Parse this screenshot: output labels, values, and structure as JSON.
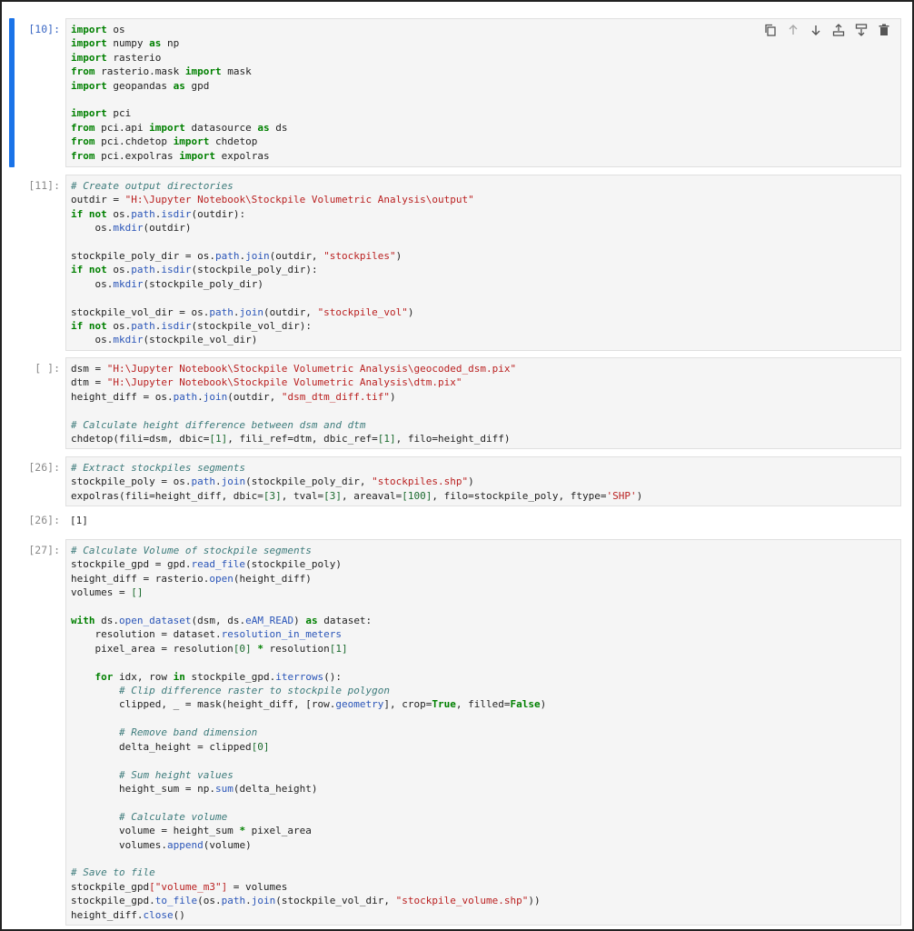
{
  "cells": [
    {
      "prompt": "[10]:",
      "active": true,
      "lines": [
        [
          [
            "k",
            "import"
          ],
          [
            "t",
            " os"
          ]
        ],
        [
          [
            "k",
            "import"
          ],
          [
            "t",
            " numpy "
          ],
          [
            "k",
            "as"
          ],
          [
            "t",
            " np"
          ]
        ],
        [
          [
            "k",
            "import"
          ],
          [
            "t",
            " rasterio"
          ]
        ],
        [
          [
            "k",
            "from"
          ],
          [
            "t",
            " rasterio.mask "
          ],
          [
            "k",
            "import"
          ],
          [
            "t",
            " mask"
          ]
        ],
        [
          [
            "k",
            "import"
          ],
          [
            "t",
            " geopandas "
          ],
          [
            "k",
            "as"
          ],
          [
            "t",
            " gpd"
          ]
        ],
        [],
        [
          [
            "k",
            "import"
          ],
          [
            "t",
            " pci"
          ]
        ],
        [
          [
            "k",
            "from"
          ],
          [
            "t",
            " pci.api "
          ],
          [
            "k",
            "import"
          ],
          [
            "t",
            " datasource "
          ],
          [
            "k",
            "as"
          ],
          [
            "t",
            " ds"
          ]
        ],
        [
          [
            "k",
            "from"
          ],
          [
            "t",
            " pci.chdetop "
          ],
          [
            "k",
            "import"
          ],
          [
            "t",
            " chdetop"
          ]
        ],
        [
          [
            "k",
            "from"
          ],
          [
            "t",
            " pci.expolras "
          ],
          [
            "k",
            "import"
          ],
          [
            "t",
            " expolras"
          ]
        ]
      ]
    },
    {
      "prompt": "[11]:",
      "lines": [
        [
          [
            "c",
            "# Create output directories"
          ]
        ],
        [
          [
            "t",
            "outdir = "
          ],
          [
            "s",
            "\"H:\\Jupyter Notebook\\Stockpile Volumetric Analysis\\output\""
          ]
        ],
        [
          [
            "k",
            "if not"
          ],
          [
            "t",
            " os."
          ],
          [
            "a",
            "path"
          ],
          [
            "t",
            "."
          ],
          [
            "a",
            "isdir"
          ],
          [
            "t",
            "(outdir):"
          ]
        ],
        [
          [
            "t",
            "    os."
          ],
          [
            "a",
            "mkdir"
          ],
          [
            "t",
            "(outdir)"
          ]
        ],
        [],
        [
          [
            "t",
            "stockpile_poly_dir = os."
          ],
          [
            "a",
            "path"
          ],
          [
            "t",
            "."
          ],
          [
            "a",
            "join"
          ],
          [
            "t",
            "(outdir, "
          ],
          [
            "s",
            "\"stockpiles\""
          ],
          [
            "t",
            ")"
          ]
        ],
        [
          [
            "k",
            "if not"
          ],
          [
            "t",
            " os."
          ],
          [
            "a",
            "path"
          ],
          [
            "t",
            "."
          ],
          [
            "a",
            "isdir"
          ],
          [
            "t",
            "(stockpile_poly_dir):"
          ]
        ],
        [
          [
            "t",
            "    os."
          ],
          [
            "a",
            "mkdir"
          ],
          [
            "t",
            "(stockpile_poly_dir)"
          ]
        ],
        [],
        [
          [
            "t",
            "stockpile_vol_dir = os."
          ],
          [
            "a",
            "path"
          ],
          [
            "t",
            "."
          ],
          [
            "a",
            "join"
          ],
          [
            "t",
            "(outdir, "
          ],
          [
            "s",
            "\"stockpile_vol\""
          ],
          [
            "t",
            ")"
          ]
        ],
        [
          [
            "k",
            "if not"
          ],
          [
            "t",
            " os."
          ],
          [
            "a",
            "path"
          ],
          [
            "t",
            "."
          ],
          [
            "a",
            "isdir"
          ],
          [
            "t",
            "(stockpile_vol_dir):"
          ]
        ],
        [
          [
            "t",
            "    os."
          ],
          [
            "a",
            "mkdir"
          ],
          [
            "t",
            "(stockpile_vol_dir)"
          ]
        ]
      ]
    },
    {
      "prompt": "[ ]:",
      "lines": [
        [
          [
            "t",
            "dsm = "
          ],
          [
            "s",
            "\"H:\\Jupyter Notebook\\Stockpile Volumetric Analysis\\geocoded_dsm.pix\""
          ]
        ],
        [
          [
            "t",
            "dtm = "
          ],
          [
            "s",
            "\"H:\\Jupyter Notebook\\Stockpile Volumetric Analysis\\dtm.pix\""
          ]
        ],
        [
          [
            "t",
            "height_diff = os."
          ],
          [
            "a",
            "path"
          ],
          [
            "t",
            "."
          ],
          [
            "a",
            "join"
          ],
          [
            "t",
            "(outdir, "
          ],
          [
            "s",
            "\"dsm_dtm_diff.tif\""
          ],
          [
            "t",
            ")"
          ]
        ],
        [],
        [
          [
            "c",
            "# Calculate height difference between dsm and dtm"
          ]
        ],
        [
          [
            "t",
            "chdetop(fili=dsm, dbic="
          ],
          [
            "n",
            "[1]"
          ],
          [
            "t",
            ", fili_ref=dtm, dbic_ref="
          ],
          [
            "n",
            "[1]"
          ],
          [
            "t",
            ", filo=height_diff)"
          ]
        ]
      ]
    },
    {
      "prompt": "[26]:",
      "lines": [
        [
          [
            "c",
            "# Extract stockpiles segments"
          ]
        ],
        [
          [
            "t",
            "stockpile_poly = os."
          ],
          [
            "a",
            "path"
          ],
          [
            "t",
            "."
          ],
          [
            "a",
            "join"
          ],
          [
            "t",
            "(stockpile_poly_dir, "
          ],
          [
            "s",
            "\"stockpiles.shp\""
          ],
          [
            "t",
            ")"
          ]
        ],
        [
          [
            "t",
            "expolras(fili=height_diff, dbic="
          ],
          [
            "n",
            "[3]"
          ],
          [
            "t",
            ", tval="
          ],
          [
            "n",
            "[3]"
          ],
          [
            "t",
            ", areaval="
          ],
          [
            "n",
            "[100]"
          ],
          [
            "t",
            ", filo=stockpile_poly, ftype="
          ],
          [
            "s",
            "'SHP'"
          ],
          [
            "t",
            ")"
          ]
        ]
      ]
    },
    {
      "prompt": "[27]:",
      "lines": [
        [
          [
            "c",
            "# Calculate Volume of stockpile segments"
          ]
        ],
        [
          [
            "t",
            "stockpile_gpd = gpd."
          ],
          [
            "a",
            "read_file"
          ],
          [
            "t",
            "(stockpile_poly)"
          ]
        ],
        [
          [
            "t",
            "height_diff = rasterio."
          ],
          [
            "a",
            "open"
          ],
          [
            "t",
            "(height_diff)"
          ]
        ],
        [
          [
            "t",
            "volumes = "
          ],
          [
            "n",
            "[]"
          ]
        ],
        [],
        [
          [
            "k",
            "with"
          ],
          [
            "t",
            " ds."
          ],
          [
            "a",
            "open_dataset"
          ],
          [
            "t",
            "(dsm, ds."
          ],
          [
            "a",
            "eAM_READ"
          ],
          [
            "t",
            ") "
          ],
          [
            "k",
            "as"
          ],
          [
            "t",
            " dataset:"
          ]
        ],
        [
          [
            "t",
            "    resolution = dataset."
          ],
          [
            "a",
            "resolution_in_meters"
          ]
        ],
        [
          [
            "t",
            "    pixel_area = resolution"
          ],
          [
            "n",
            "[0]"
          ],
          [
            "t",
            " "
          ],
          [
            "k",
            "*"
          ],
          [
            "t",
            " resolution"
          ],
          [
            "n",
            "[1]"
          ]
        ],
        [],
        [
          [
            "t",
            "    "
          ],
          [
            "k",
            "for"
          ],
          [
            "t",
            " idx, row "
          ],
          [
            "k",
            "in"
          ],
          [
            "t",
            " stockpile_gpd."
          ],
          [
            "a",
            "iterrows"
          ],
          [
            "t",
            "():"
          ]
        ],
        [
          [
            "t",
            "        "
          ],
          [
            "c",
            "# Clip difference raster to stockpile polygon"
          ]
        ],
        [
          [
            "t",
            "        clipped, _ = mask(height_diff, [row."
          ],
          [
            "a",
            "geometry"
          ],
          [
            "t",
            "], crop="
          ],
          [
            "kc",
            "True"
          ],
          [
            "t",
            ", filled="
          ],
          [
            "kc",
            "False"
          ],
          [
            "t",
            ")"
          ]
        ],
        [],
        [
          [
            "t",
            "        "
          ],
          [
            "c",
            "# Remove band dimension"
          ]
        ],
        [
          [
            "t",
            "        delta_height = clipped"
          ],
          [
            "n",
            "[0]"
          ]
        ],
        [],
        [
          [
            "t",
            "        "
          ],
          [
            "c",
            "# Sum height values"
          ]
        ],
        [
          [
            "t",
            "        height_sum = np."
          ],
          [
            "a",
            "sum"
          ],
          [
            "t",
            "(delta_height)"
          ]
        ],
        [],
        [
          [
            "t",
            "        "
          ],
          [
            "c",
            "# Calculate volume"
          ]
        ],
        [
          [
            "t",
            "        volume = height_sum "
          ],
          [
            "k",
            "*"
          ],
          [
            "t",
            " pixel_area"
          ]
        ],
        [
          [
            "t",
            "        volumes."
          ],
          [
            "a",
            "append"
          ],
          [
            "t",
            "(volume)"
          ]
        ],
        [],
        [
          [
            "c",
            "# Save to file"
          ]
        ],
        [
          [
            "t",
            "stockpile_gpd"
          ],
          [
            "s",
            "[\"volume_m3\"]"
          ],
          [
            "t",
            " = volumes"
          ]
        ],
        [
          [
            "t",
            "stockpile_gpd."
          ],
          [
            "a",
            "to_file"
          ],
          [
            "t",
            "(os."
          ],
          [
            "a",
            "path"
          ],
          [
            "t",
            "."
          ],
          [
            "a",
            "join"
          ],
          [
            "t",
            "(stockpile_vol_dir, "
          ],
          [
            "s",
            "\"stockpile_volume.shp\""
          ],
          [
            "t",
            "))"
          ]
        ],
        [
          [
            "t",
            "height_diff."
          ],
          [
            "a",
            "close"
          ],
          [
            "t",
            "()"
          ]
        ]
      ]
    }
  ],
  "outputs": [
    {
      "prompt": "[26]:",
      "text": "[1]"
    }
  ],
  "toolbar": [
    "copy-icon",
    "arrow-up-icon",
    "arrow-down-icon",
    "insert-above-icon",
    "insert-below-icon",
    "trash-icon"
  ]
}
